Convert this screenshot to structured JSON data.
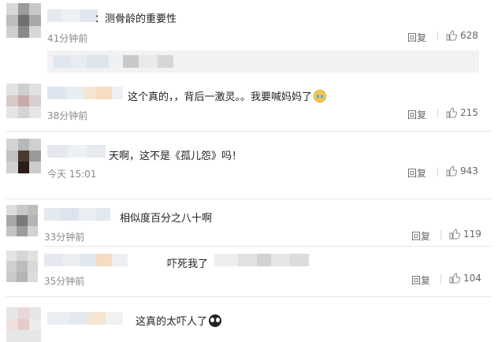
{
  "comments": [
    {
      "text": "：测骨龄的重要性",
      "time": "41分钟前",
      "reply": "回复",
      "likes": "628"
    },
    {
      "text": "这个真的，，背后一激灵。。我要喊妈妈了",
      "emoji": "crying-face-icon",
      "time": "38分钟前",
      "reply": "回复",
      "likes": "215"
    },
    {
      "text": "天啊，这不是《孤儿怨》吗！",
      "time": "今天 15:01",
      "reply": "回复",
      "likes": "943"
    },
    {
      "text": "相似度百分之八十啊",
      "time": "33分钟前",
      "reply": "回复",
      "likes": "119"
    },
    {
      "text": "吓死我了",
      "time": "35分钟前",
      "reply": "回复",
      "likes": "104"
    },
    {
      "text": "这真的太吓人了",
      "emoji": "scared-face-icon"
    }
  ],
  "colors": {
    "text": "#222222",
    "meta": "#8a8a8a",
    "divider": "#e6e6e6",
    "quote_bg": "#f2f2f2"
  }
}
